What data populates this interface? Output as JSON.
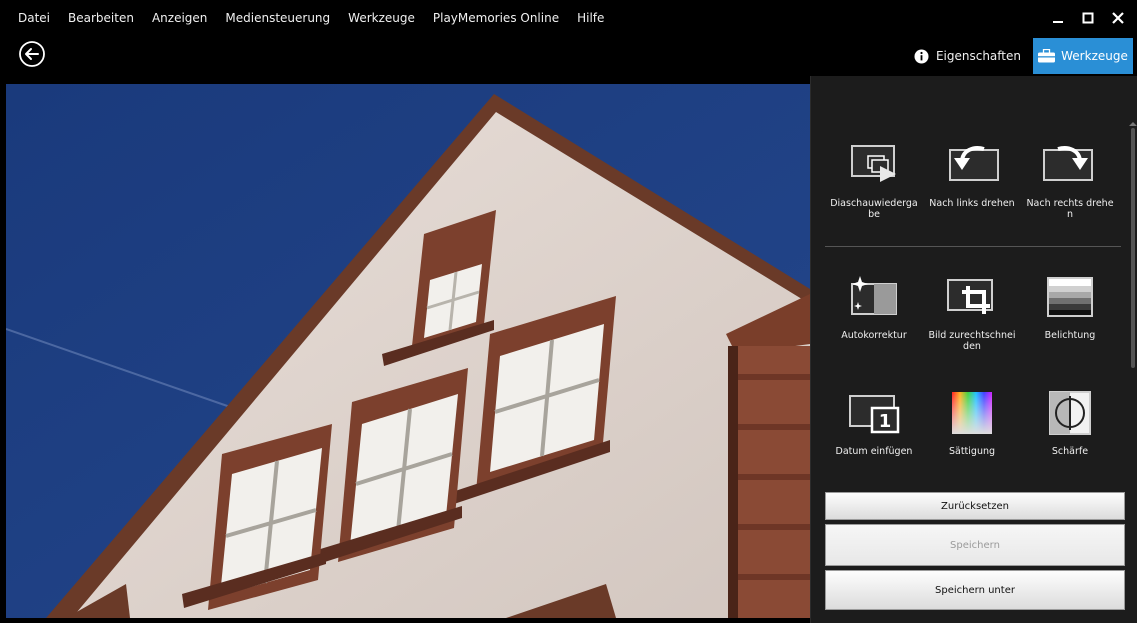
{
  "menu": [
    "Datei",
    "Bearbeiten",
    "Anzeigen",
    "Mediensteuerung",
    "Werkzeuge",
    "PlayMemories Online",
    "Hilfe"
  ],
  "toolbar": {
    "properties_label": "Eigenschaften",
    "tools_label": "Werkzeuge"
  },
  "tools_row1": [
    {
      "label": "Diaschauwiedergabe",
      "icon": "slideshow-icon"
    },
    {
      "label": "Nach links drehen",
      "icon": "rotate-left-icon"
    },
    {
      "label": "Nach rechts drehen",
      "icon": "rotate-right-icon"
    }
  ],
  "tools_row2": [
    {
      "label": "Autokorrektur",
      "icon": "auto-correct-icon"
    },
    {
      "label": "Bild zurechtschneiden",
      "icon": "crop-icon"
    },
    {
      "label": "Belichtung",
      "icon": "exposure-icon"
    }
  ],
  "tools_row3": [
    {
      "label": "Datum einfügen",
      "icon": "insert-date-icon"
    },
    {
      "label": "Sättigung",
      "icon": "saturation-icon"
    },
    {
      "label": "Schärfe",
      "icon": "sharpness-icon"
    }
  ],
  "buttons": {
    "reset": "Zurücksetzen",
    "save": "Speichern",
    "save_as": "Speichern unter"
  },
  "colors": {
    "accent": "#2a8fd6",
    "panel_bg": "#1c1c1c",
    "sky": "#1d3f83"
  }
}
